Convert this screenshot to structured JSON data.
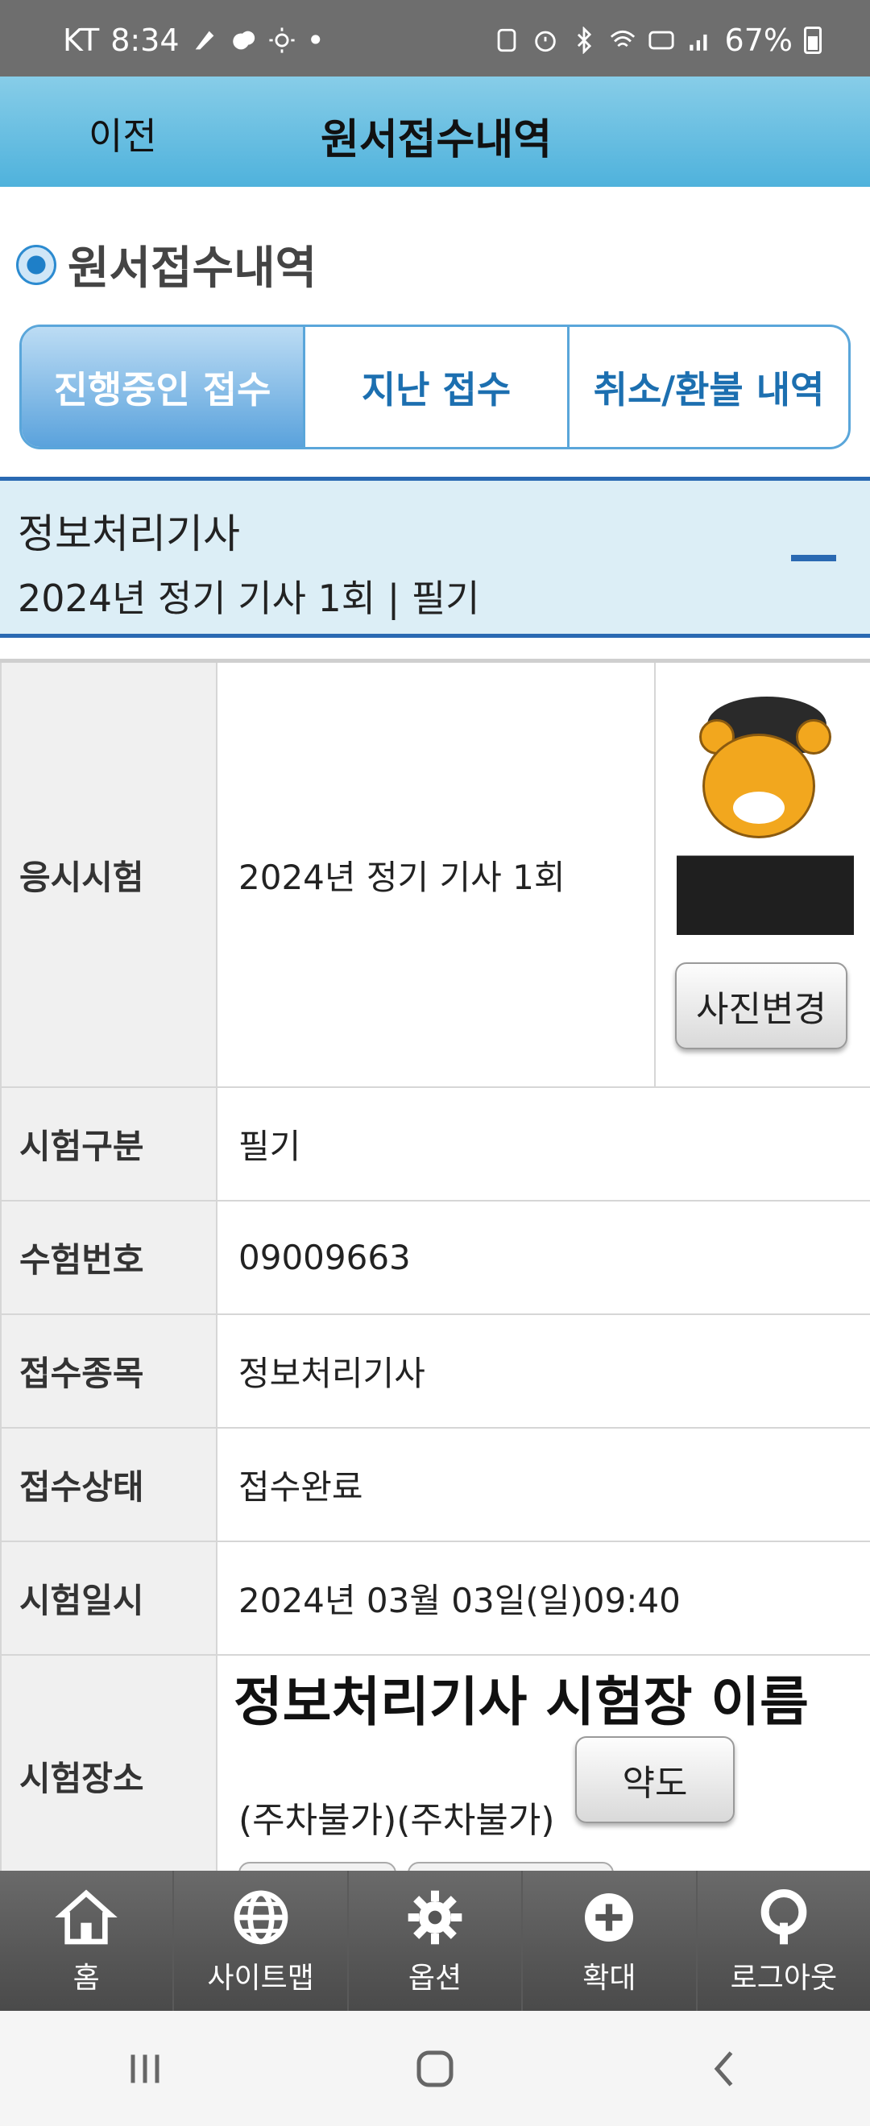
{
  "status_bar": {
    "carrier": "KT",
    "time": "8:34",
    "battery": "67%"
  },
  "header": {
    "back_label": "이전",
    "title": "원서접수내역"
  },
  "section": {
    "title": "원서접수내역"
  },
  "tabs": [
    {
      "label": "진행중인 접수",
      "active": true
    },
    {
      "label": "지난 접수",
      "active": false
    },
    {
      "label": "취소/환불 내역",
      "active": false
    }
  ],
  "exam": {
    "name": "정보처리기사",
    "subtitle": "2024년 정기 기사 1회 | 필기"
  },
  "table": {
    "exam_label": "응시시험",
    "exam_value": "2024년 정기 기사 1회",
    "photo_button": "사진변경",
    "type_label": "시험구분",
    "type_value": "필기",
    "number_label": "수험번호",
    "number_value": "09009663",
    "category_label": "접수종목",
    "category_value": "정보처리기사",
    "status_label": "접수상태",
    "status_value": "접수완료",
    "date_label": "시험일시",
    "date_value": "2024년 03월 03일(일)09:40",
    "place_label": "시험장소",
    "place_name": "정보처리기사 시험장 이름",
    "place_note": "(주차불가)(주차불가)",
    "map_button": "약도"
  },
  "bottom_nav": [
    {
      "label": "홈",
      "icon": "home-icon"
    },
    {
      "label": "사이트맵",
      "icon": "globe-icon"
    },
    {
      "label": "옵션",
      "icon": "gear-icon"
    },
    {
      "label": "확대",
      "icon": "plus-icon"
    },
    {
      "label": "로그아웃",
      "icon": "logout-icon"
    }
  ],
  "colors": {
    "header": "#4fb2dc",
    "accent": "#2a69b2",
    "status": "#0a2fd0"
  }
}
